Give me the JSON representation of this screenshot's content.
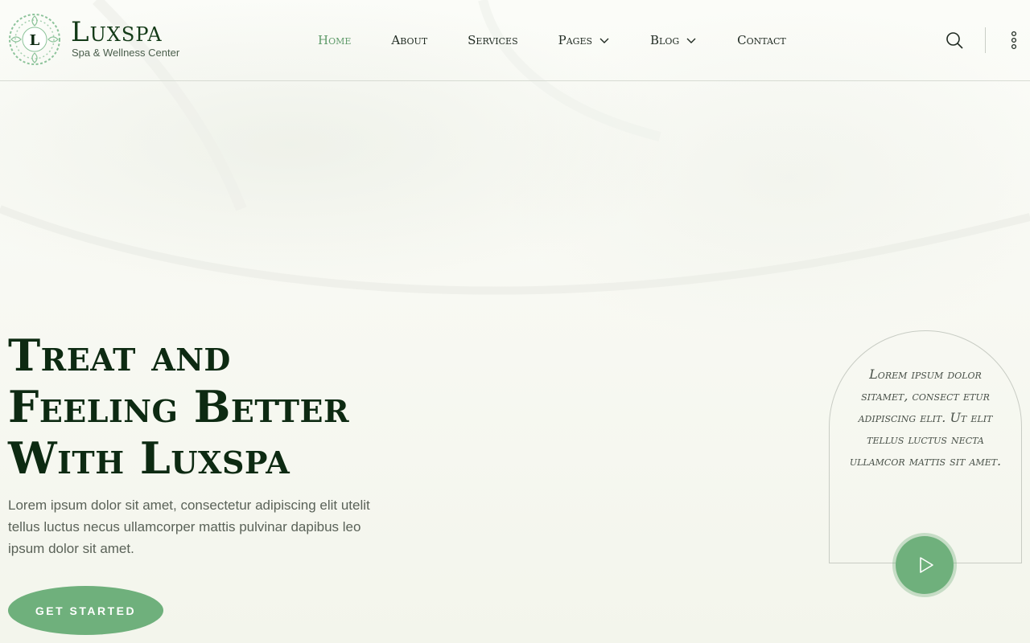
{
  "brand": {
    "name": "Luxspa",
    "tagline": "Spa & Wellness Center",
    "monogram": "L",
    "accent_color": "#6fb07c",
    "dark_color": "#0d2a12"
  },
  "nav": {
    "items": [
      {
        "label": "Home",
        "active": true
      },
      {
        "label": "About"
      },
      {
        "label": "Services"
      },
      {
        "label": "Pages",
        "dropdown": true
      },
      {
        "label": "Blog",
        "dropdown": true
      },
      {
        "label": "Contact"
      }
    ],
    "search_icon": "search-icon",
    "more_icon": "more-vertical-icon"
  },
  "hero": {
    "title_lines": [
      "Treat and",
      "Feeling Better",
      "With Luxspa"
    ],
    "description": "Lorem ipsum dolor sit amet, consectetur adipiscing elit utelit tellus luctus necus ullamcorper mattis pulvinar dapibus leo ipsum dolor sit amet.",
    "cta_label": "GET STARTED"
  },
  "card": {
    "text": "Lorem ipsum dolor sitamet, consect etur adipiscing elit. Ut elit tellus luctus necta ullamcor mattis sit amet.",
    "play_icon": "play-icon"
  }
}
